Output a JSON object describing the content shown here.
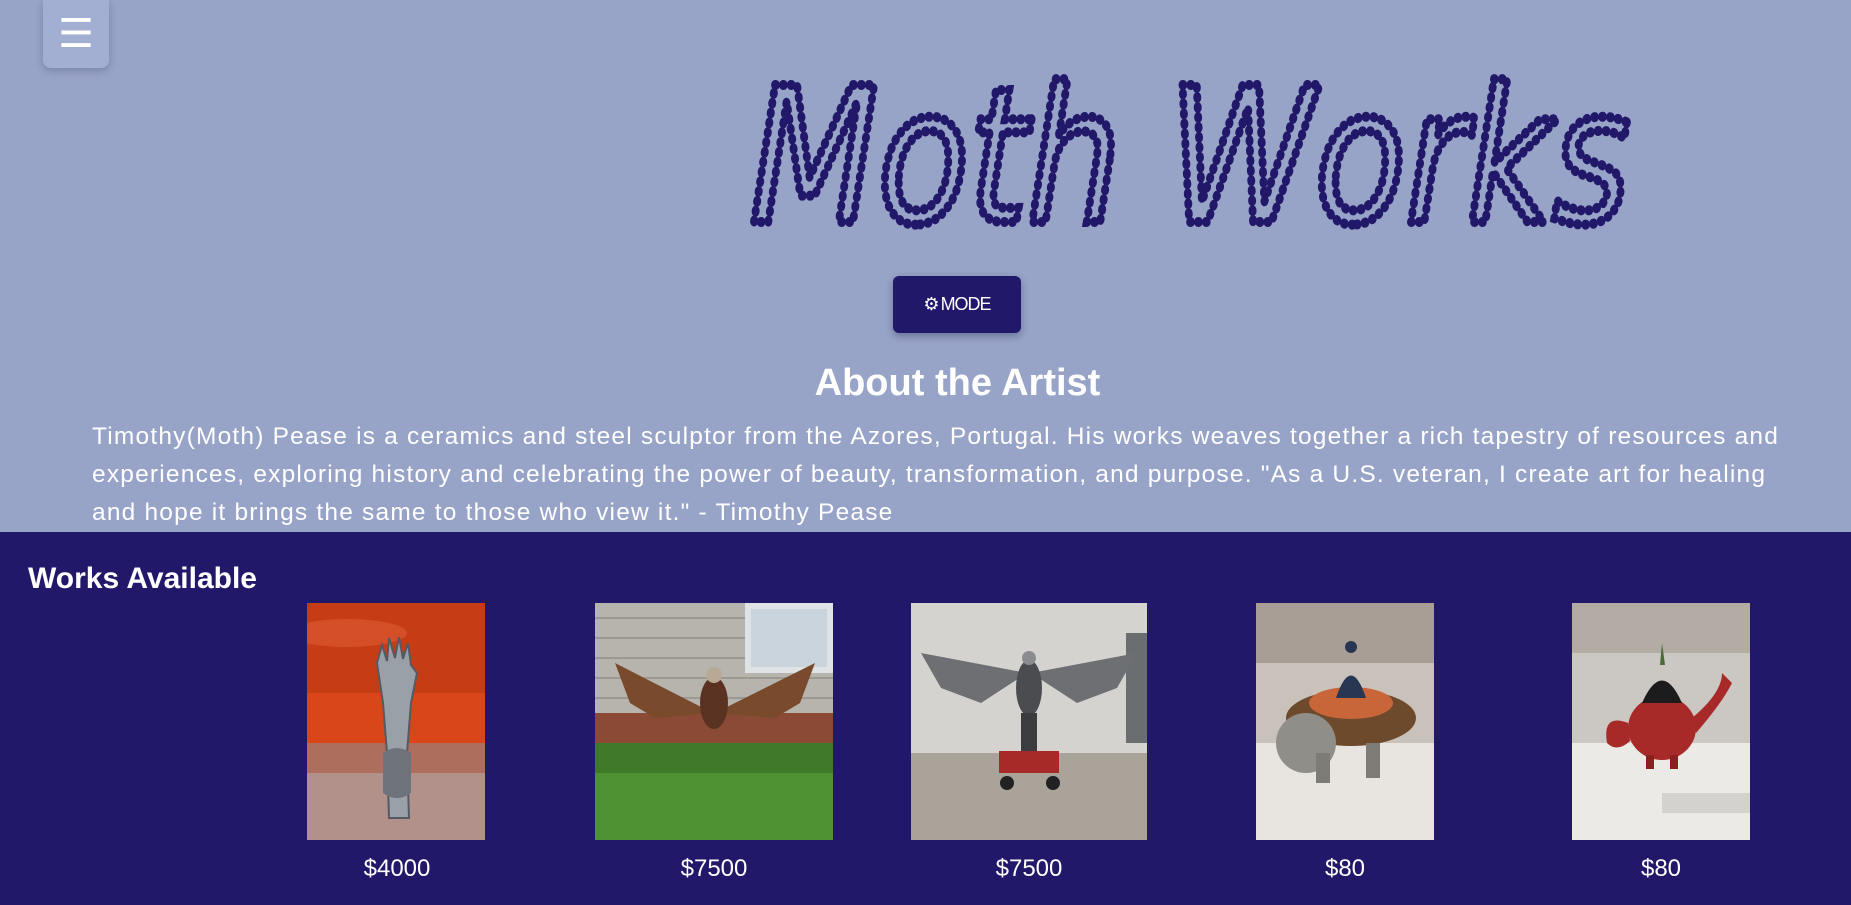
{
  "header": {
    "menu_icon": "hamburger-menu-icon",
    "menu_glyph": "☰",
    "logo_text": "Moth Works",
    "mode_button": {
      "icon": "gear-icon",
      "icon_glyph": "⚙",
      "label": "MODE"
    }
  },
  "about": {
    "title": "About the Artist",
    "text": "Timothy(Moth) Pease is a ceramics and steel sculptor from the Azores, Portugal. His works weaves together a rich tapestry of resources and experiences, exploring history and celebrating the power of beauty, transformation, and purpose. \"As a U.S. veteran, I create art for healing and hope it brings the same to those who view it.\" - Timothy Pease"
  },
  "works": {
    "title": "Works Available",
    "items": [
      {
        "price": "$4000"
      },
      {
        "price": "$7500"
      },
      {
        "price": "$7500"
      },
      {
        "price": "$80"
      },
      {
        "price": "$80"
      }
    ]
  },
  "colors": {
    "page_background": "#98a3c8",
    "accent": "#211869",
    "text_light": "#ffffff"
  }
}
